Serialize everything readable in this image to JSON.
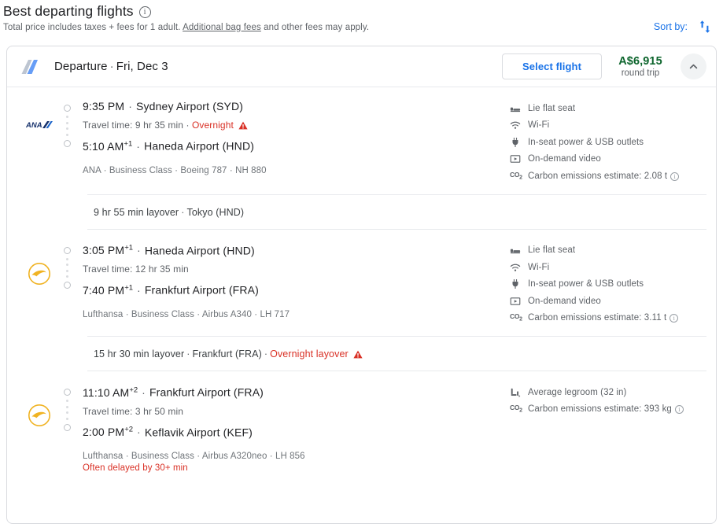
{
  "header": {
    "title": "Best departing flights",
    "info_icon": "info-icon",
    "subtitle_before": "Total price includes taxes + fees for 1 adult. ",
    "subtitle_link": "Additional bag fees",
    "subtitle_after": " and other fees may apply.",
    "sort_label": "Sort by:",
    "sort_icon": "sort-arrows-icon"
  },
  "card": {
    "tail_icon": "airplane-tail-icon",
    "departure_label": "Departure",
    "departure_date": "Fri, Dec 3",
    "select_flight_label": "Select flight",
    "price": "A$6,915",
    "price_sub": "round trip",
    "collapse_icon": "chevron-up-icon"
  },
  "segments": [
    {
      "airline_logo": "ana-logo",
      "depart_time": "9:35 PM",
      "depart_sup": "",
      "depart_airport": "Sydney Airport (SYD)",
      "travel_time": "Travel time: 9 hr 35 min",
      "travel_warning": "Overnight",
      "warning_icon": "warning-triangle-icon",
      "arrive_time": "5:10 AM",
      "arrive_sup": "+1",
      "arrive_airport": "Haneda Airport (HND)",
      "meta": "ANA · Business Class · Boeing 787 · NH 880",
      "delay_note": "",
      "amenities": [
        {
          "icon": "lie-flat-seat-icon",
          "label": "Lie flat seat",
          "info": false
        },
        {
          "icon": "wifi-icon",
          "label": "Wi-Fi",
          "info": false
        },
        {
          "icon": "power-outlet-icon",
          "label": "In-seat power & USB outlets",
          "info": false
        },
        {
          "icon": "video-icon",
          "label": "On-demand video",
          "info": false
        },
        {
          "icon": "co2-icon",
          "label": "Carbon emissions estimate: 2.08 t",
          "info": true
        }
      ]
    },
    {
      "airline_logo": "lufthansa-logo",
      "depart_time": "3:05 PM",
      "depart_sup": "+1",
      "depart_airport": "Haneda Airport (HND)",
      "travel_time": "Travel time: 12 hr 35 min",
      "travel_warning": "",
      "warning_icon": "",
      "arrive_time": "7:40 PM",
      "arrive_sup": "+1",
      "arrive_airport": "Frankfurt Airport (FRA)",
      "meta": "Lufthansa · Business Class · Airbus A340 · LH 717",
      "delay_note": "",
      "amenities": [
        {
          "icon": "lie-flat-seat-icon",
          "label": "Lie flat seat",
          "info": false
        },
        {
          "icon": "wifi-icon",
          "label": "Wi-Fi",
          "info": false
        },
        {
          "icon": "power-outlet-icon",
          "label": "In-seat power & USB outlets",
          "info": false
        },
        {
          "icon": "video-icon",
          "label": "On-demand video",
          "info": false
        },
        {
          "icon": "co2-icon",
          "label": "Carbon emissions estimate: 3.11 t",
          "info": true
        }
      ]
    },
    {
      "airline_logo": "lufthansa-logo",
      "depart_time": "11:10 AM",
      "depart_sup": "+2",
      "depart_airport": "Frankfurt Airport (FRA)",
      "travel_time": "Travel time: 3 hr 50 min",
      "travel_warning": "",
      "warning_icon": "",
      "arrive_time": "2:00 PM",
      "arrive_sup": "+2",
      "arrive_airport": "Keflavik Airport (KEF)",
      "meta": "Lufthansa · Business Class · Airbus A320neo · LH 856",
      "delay_note": "Often delayed by 30+ min",
      "amenities": [
        {
          "icon": "legroom-icon",
          "label": "Average legroom (32 in)",
          "info": false
        },
        {
          "icon": "co2-icon",
          "label": "Carbon emissions estimate: 393 kg",
          "info": true
        }
      ]
    }
  ],
  "layovers": [
    {
      "duration": "9 hr 55 min layover",
      "place": "Tokyo (HND)",
      "warning": "",
      "warning_icon": ""
    },
    {
      "duration": "15 hr 30 min layover",
      "place": "Frankfurt (FRA)",
      "warning": "Overnight layover",
      "warning_icon": "warning-triangle-icon"
    }
  ],
  "colors": {
    "link_blue": "#1a73e8",
    "price_green": "#0d652d",
    "warning_red": "#d93025",
    "lufthansa_yellow": "#f0b323",
    "ana_navy": "#1b3a73"
  }
}
